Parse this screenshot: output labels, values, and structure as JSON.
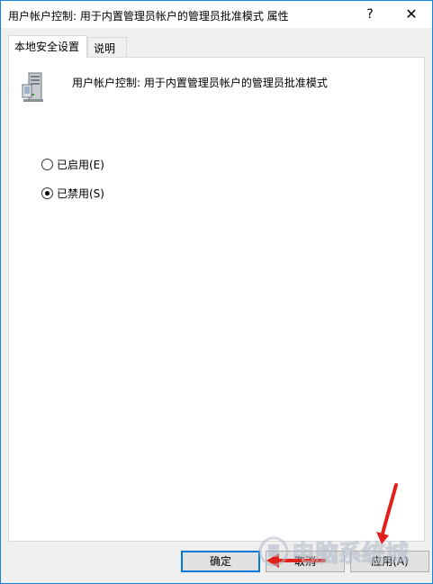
{
  "window": {
    "title": "用户帐户控制: 用于内置管理员帐户的管理员批准模式 属性",
    "help_label": "?",
    "close_label": "✕"
  },
  "tabs": [
    {
      "label": "本地安全设置",
      "active": true
    },
    {
      "label": "说明",
      "active": false
    }
  ],
  "policy": {
    "icon": "server-computer-icon",
    "title": "用户帐户控制: 用于内置管理员帐户的管理员批准模式"
  },
  "options": [
    {
      "label": "已启用(E)",
      "checked": false
    },
    {
      "label": "已禁用(S)",
      "checked": true
    }
  ],
  "buttons": {
    "ok_label": "确定",
    "cancel_label": "取消",
    "apply_label": "应用(A)"
  },
  "colors": {
    "accent": "#0078d7",
    "annotation": "#e0211a"
  },
  "watermark": {
    "text": "电脑系统城"
  }
}
